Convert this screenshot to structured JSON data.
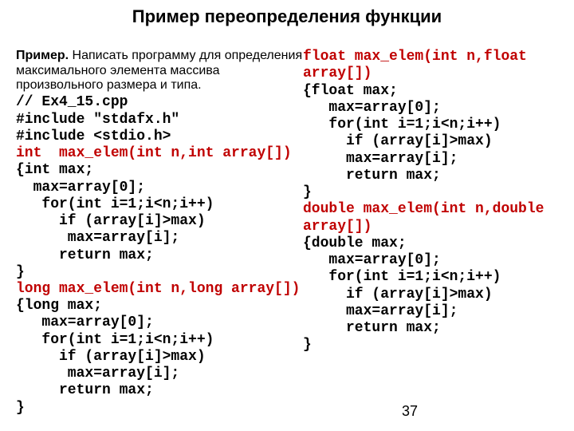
{
  "title": "Пример переопределения функции",
  "intro_label": "Пример.",
  "intro_rest": " Написать программу для определения максимального элемента массива произвольного размера и типа.",
  "left": {
    "l01": "// Ex4_15.cpp",
    "l02": "#include \"stdafx.h\"",
    "l03": "#include <stdio.h>",
    "l04": "int  max_elem(int n,int array[])",
    "l05": "{int max;",
    "l06": "  max=array[0];",
    "l07": "   for(int i=1;i<n;i++)",
    "l08": "     if (array[i]>max)",
    "l09": "      max=array[i];",
    "l10": "     return max;",
    "l11": "}",
    "l12": "long max_elem(int n,long array[])",
    "l13": "{long max;",
    "l14": "   max=array[0];",
    "l15": "   for(int i=1;i<n;i++)",
    "l16": "     if (array[i]>max)",
    "l17": "      max=array[i];",
    "l18": "     return max;",
    "l19": "}"
  },
  "right": {
    "r01a": "float max_elem(int n,float",
    "r01b": "array[])",
    "r02": "{float max;",
    "r03": "   max=array[0];",
    "r04": "   for(int i=1;i<n;i++)",
    "r05": "     if (array[i]>max)",
    "r06": "     max=array[i];",
    "r07": "     return max;",
    "r08": "}",
    "r09a": "double max_elem(int n,double",
    "r09b": "array[])",
    "r10": "{double max;",
    "r11": "   max=array[0];",
    "r12": "   for(int i=1;i<n;i++)",
    "r13": "     if (array[i]>max)",
    "r14": "     max=array[i];",
    "r15": "     return max;",
    "r16": "}"
  },
  "page_number": "37"
}
